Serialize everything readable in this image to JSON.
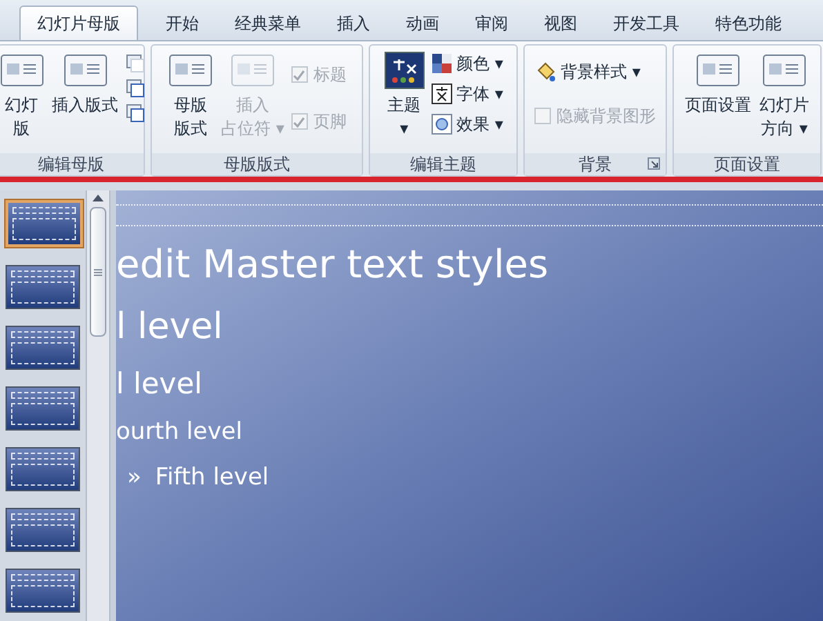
{
  "tabs": [
    {
      "label": "幻灯片母版",
      "selected": true
    },
    {
      "label": "开始",
      "selected": false
    },
    {
      "label": "经典菜单",
      "selected": false
    },
    {
      "label": "插入",
      "selected": false
    },
    {
      "label": "动画",
      "selected": false
    },
    {
      "label": "审阅",
      "selected": false
    },
    {
      "label": "视图",
      "selected": false
    },
    {
      "label": "开发工具",
      "selected": false
    },
    {
      "label": "特色功能",
      "selected": false
    }
  ],
  "ribbon_groups": [
    {
      "label": "编辑母版",
      "items": [
        {
          "kind": "big",
          "lines": [
            "幻灯",
            "版"
          ],
          "disabled": false
        },
        {
          "kind": "big",
          "lines": [
            "插入版式"
          ],
          "disabled": false
        },
        {
          "kind": "icons"
        }
      ]
    },
    {
      "label": "母版版式",
      "items": [
        {
          "kind": "big",
          "lines": [
            "母版",
            "版式"
          ],
          "disabled": false
        },
        {
          "kind": "big",
          "lines": [
            "插入",
            "占位符 ▾"
          ],
          "disabled": true
        },
        {
          "kind": "checks",
          "checks": [
            {
              "label": "标题",
              "checked": true,
              "disabled": true
            },
            {
              "label": "页脚",
              "checked": true,
              "disabled": true
            }
          ]
        }
      ]
    },
    {
      "label": "编辑主题",
      "items": [
        {
          "kind": "theme",
          "lines": [
            "主题",
            "▾"
          ]
        },
        {
          "kind": "menus",
          "menus": [
            {
              "label": "颜色 ▾"
            },
            {
              "label": "字体 ▾"
            },
            {
              "label": "效果 ▾"
            }
          ]
        }
      ]
    },
    {
      "label": "背景",
      "launcher": true,
      "items": [
        {
          "kind": "background",
          "menu": "背景样式 ▾",
          "check": {
            "label": "隐藏背景图形",
            "checked": false,
            "disabled": true
          }
        }
      ]
    },
    {
      "label": "页面设置",
      "items": [
        {
          "kind": "big",
          "lines": [
            "页面设置"
          ],
          "disabled": false
        },
        {
          "kind": "big",
          "lines": [
            "幻灯片",
            "方向 ▾"
          ],
          "disabled": false
        }
      ]
    }
  ],
  "thumbnails": [
    {
      "selected": true
    },
    {
      "selected": false
    },
    {
      "selected": false
    },
    {
      "selected": false
    },
    {
      "selected": false
    },
    {
      "selected": false
    },
    {
      "selected": false
    }
  ],
  "slide": {
    "title": "edit Master text styles",
    "levels": [
      {
        "text": "l level",
        "kind": "second"
      },
      {
        "text": "l level",
        "kind": "third"
      },
      {
        "text": "ourth level",
        "kind": "fourth"
      },
      {
        "text": "Fifth level",
        "bullet": "»",
        "kind": "fifth"
      }
    ]
  }
}
